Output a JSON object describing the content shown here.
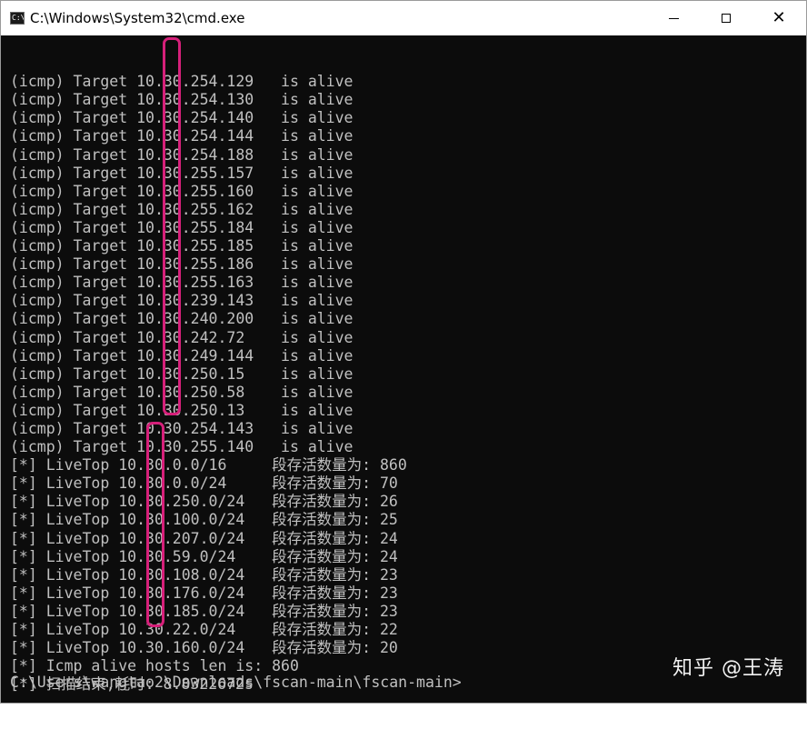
{
  "window": {
    "title": "C:\\Windows\\System32\\cmd.exe",
    "app_icon_text": "C:\\."
  },
  "caption_buttons": {
    "minimize_icon": "minimize-icon",
    "maximize_icon": "maximize-icon",
    "close_icon": "close-icon"
  },
  "console": {
    "lines": [
      "(icmp) Target 10.30.254.129   is alive",
      "(icmp) Target 10.30.254.130   is alive",
      "(icmp) Target 10.30.254.140   is alive",
      "(icmp) Target 10.30.254.144   is alive",
      "(icmp) Target 10.30.254.188   is alive",
      "(icmp) Target 10.30.255.157   is alive",
      "(icmp) Target 10.30.255.160   is alive",
      "(icmp) Target 10.30.255.162   is alive",
      "(icmp) Target 10.30.255.184   is alive",
      "(icmp) Target 10.30.255.185   is alive",
      "(icmp) Target 10.30.255.186   is alive",
      "(icmp) Target 10.30.255.163   is alive",
      "(icmp) Target 10.30.239.143   is alive",
      "(icmp) Target 10.30.240.200   is alive",
      "(icmp) Target 10.30.242.72    is alive",
      "(icmp) Target 10.30.249.144   is alive",
      "(icmp) Target 10.30.250.15    is alive",
      "(icmp) Target 10.30.250.58    is alive",
      "(icmp) Target 10.30.250.13    is alive",
      "(icmp) Target 10.30.254.143   is alive",
      "(icmp) Target 10.30.255.140   is alive",
      "[*] LiveTop 10.30.0.0/16     段存活数量为: 860",
      "[*] LiveTop 10.30.0.0/24     段存活数量为: 70",
      "[*] LiveTop 10.30.250.0/24   段存活数量为: 26",
      "[*] LiveTop 10.30.100.0/24   段存活数量为: 25",
      "[*] LiveTop 10.30.207.0/24   段存活数量为: 24",
      "[*] LiveTop 10.30.59.0/24    段存活数量为: 24",
      "[*] LiveTop 10.30.108.0/24   段存活数量为: 23",
      "[*] LiveTop 10.30.176.0/24   段存活数量为: 23",
      "[*] LiveTop 10.30.185.0/24   段存活数量为: 23",
      "[*] LiveTop 10.30.22.0/24    段存活数量为: 22",
      "[*] LiveTop 10.30.160.0/24   段存活数量为: 20",
      "[*] Icmp alive hosts len is: 860",
      "[*] 扫描结束,耗时: 8.8322672s"
    ],
    "prompt": "C:\\Users\\wangtao2\\Downloads\\fscan-main\\fscan-main>"
  },
  "watermark": {
    "text": "知乎 @王涛"
  },
  "colors": {
    "console_bg": "#0c0c0c",
    "console_fg": "#c0c0c0",
    "highlight": "#d6207a"
  }
}
